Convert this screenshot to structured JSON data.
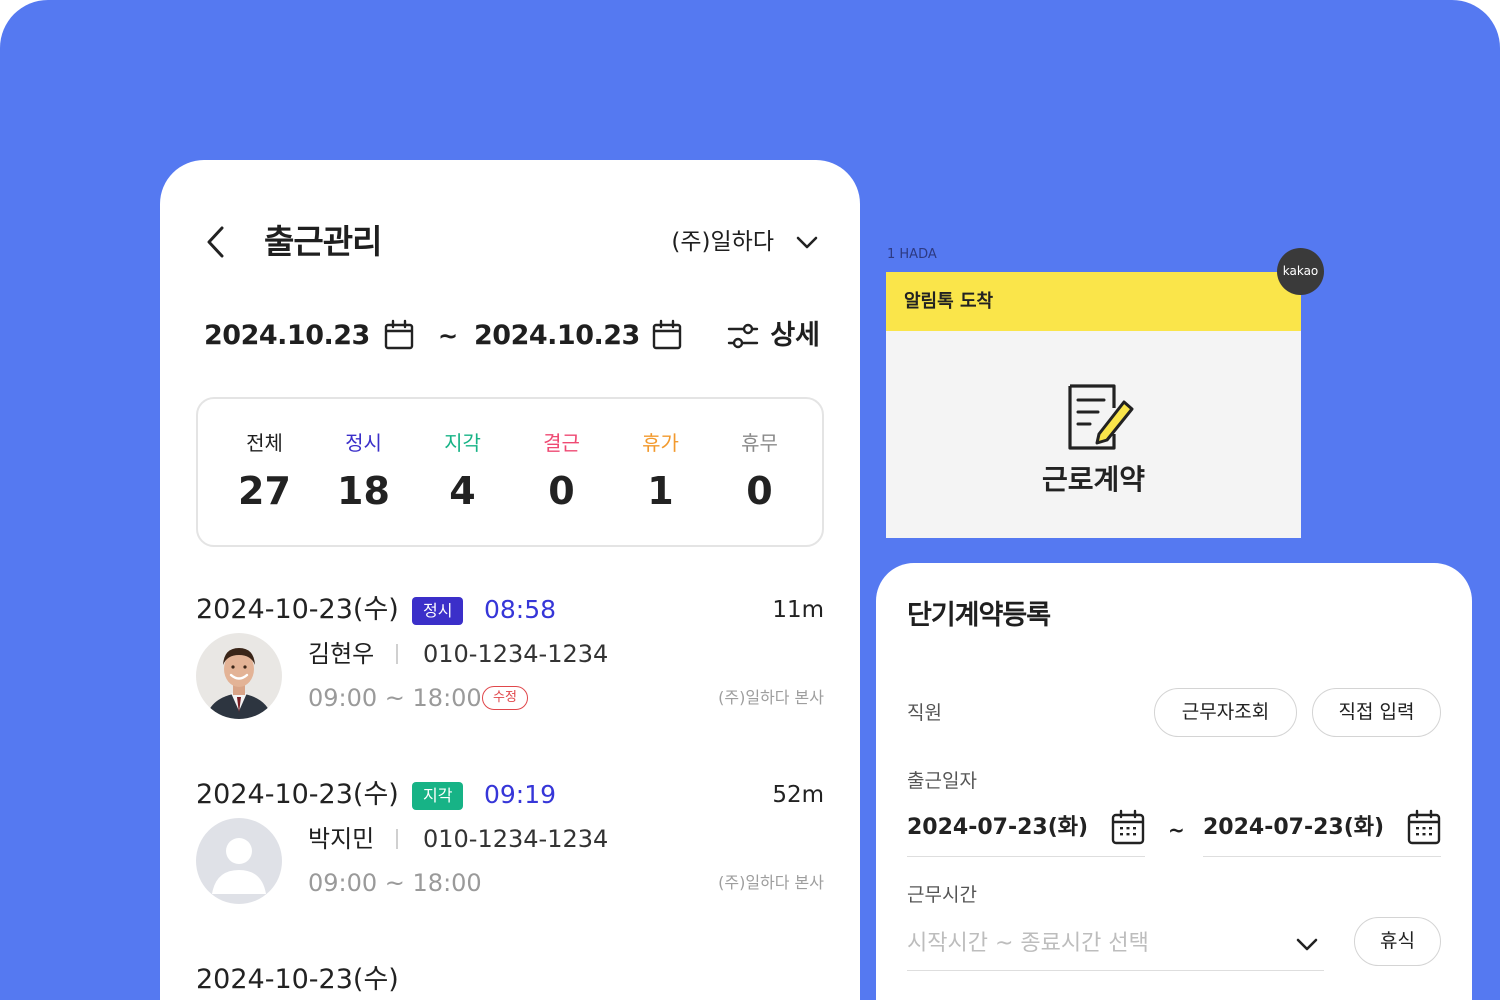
{
  "attendance": {
    "title": "출근관리",
    "company": "(주)일하다",
    "date_from": "2024.10.23",
    "date_to": "2024.10.23",
    "range_separator": "~",
    "detail_label": "상세",
    "stats": [
      {
        "label": "전체",
        "value": "27",
        "color": "#222222"
      },
      {
        "label": "정시",
        "value": "18",
        "color": "#3b2fc9"
      },
      {
        "label": "지각",
        "value": "4",
        "color": "#17b386"
      },
      {
        "label": "결근",
        "value": "0",
        "color": "#ef4a73"
      },
      {
        "label": "휴가",
        "value": "1",
        "color": "#f29a2e"
      },
      {
        "label": "휴무",
        "value": "0",
        "color": "#8a8a8a"
      }
    ],
    "records": [
      {
        "date": "2024-10-23(수)",
        "status": "정시",
        "status_color": "#3b2fc9",
        "time": "08:58",
        "duration": "11m",
        "name": "김현우",
        "phone": "010-1234-1234",
        "hours": "09:00 ~ 18:00",
        "edit_label": "수정",
        "branch": "(주)일하다 본사",
        "avatar": "photo"
      },
      {
        "date": "2024-10-23(수)",
        "status": "지각",
        "status_color": "#17b386",
        "time": "09:19",
        "duration": "52m",
        "name": "박지민",
        "phone": "010-1234-1234",
        "hours": "09:00 ~ 18:00",
        "branch": "(주)일하다 본사",
        "avatar": "placeholder"
      },
      {
        "date": "2024-10-23(수)"
      }
    ]
  },
  "kakao": {
    "sender": "1 HADA",
    "header": "알림톡 도착",
    "badge": "kakao",
    "message": "근로계약",
    "icon": "contract-edit-icon",
    "header_color": "#fae54a"
  },
  "contract_form": {
    "title": "단기계약등록",
    "employee_label": "직원",
    "search_worker_label": "근무자조회",
    "manual_input_label": "직접 입력",
    "start_date_label": "출근일자",
    "date_from": "2024-07-23(화)",
    "date_to": "2024-07-23(화)",
    "range_separator": "~",
    "work_time_label": "근무시간",
    "work_time_placeholder": "시작시간 ~ 종료시간 선택",
    "break_label": "휴식"
  },
  "colors": {
    "background": "#5579f1",
    "accent_blue": "#3636d8",
    "edit_red": "#e0474b"
  }
}
